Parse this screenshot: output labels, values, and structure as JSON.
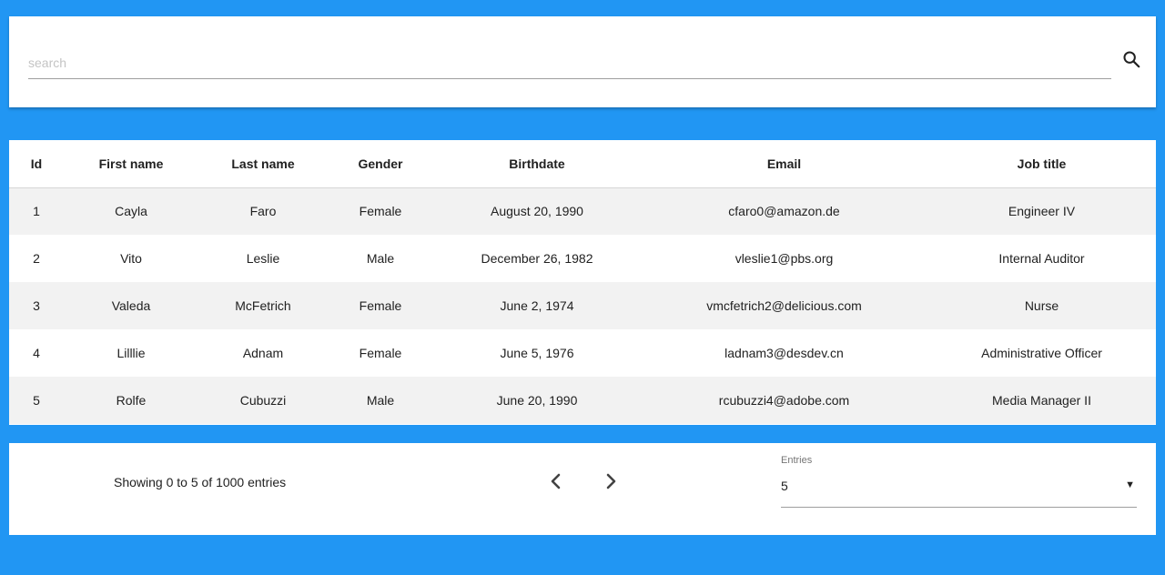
{
  "search": {
    "placeholder": "search",
    "value": ""
  },
  "table": {
    "headers": [
      "Id",
      "First name",
      "Last name",
      "Gender",
      "Birthdate",
      "Email",
      "Job title"
    ],
    "rows": [
      {
        "id": "1",
        "first_name": "Cayla",
        "last_name": "Faro",
        "gender": "Female",
        "birthdate": "August 20, 1990",
        "email": "cfaro0@amazon.de",
        "job_title": "Engineer IV"
      },
      {
        "id": "2",
        "first_name": "Vito",
        "last_name": "Leslie",
        "gender": "Male",
        "birthdate": "December 26, 1982",
        "email": "vleslie1@pbs.org",
        "job_title": "Internal Auditor"
      },
      {
        "id": "3",
        "first_name": "Valeda",
        "last_name": "McFetrich",
        "gender": "Female",
        "birthdate": "June 2, 1974",
        "email": "vmcfetrich2@delicious.com",
        "job_title": "Nurse"
      },
      {
        "id": "4",
        "first_name": "Lilllie",
        "last_name": "Adnam",
        "gender": "Female",
        "birthdate": "June 5, 1976",
        "email": "ladnam3@desdev.cn",
        "job_title": "Administrative Officer"
      },
      {
        "id": "5",
        "first_name": "Rolfe",
        "last_name": "Cubuzzi",
        "gender": "Male",
        "birthdate": "June 20, 1990",
        "email": "rcubuzzi4@adobe.com",
        "job_title": "Media Manager II"
      }
    ]
  },
  "footer": {
    "showing_text": "Showing 0 to 5 of 1000 entries",
    "entries_label": "Entries",
    "entries_value": "5"
  },
  "icons": {
    "search": "search-icon",
    "prev": "chevron-left-icon",
    "next": "chevron-right-icon",
    "dropdown": "caret-down-icon"
  },
  "colors": {
    "background": "#2196f3",
    "card": "#ffffff",
    "row_stripe": "#f2f2f2"
  }
}
